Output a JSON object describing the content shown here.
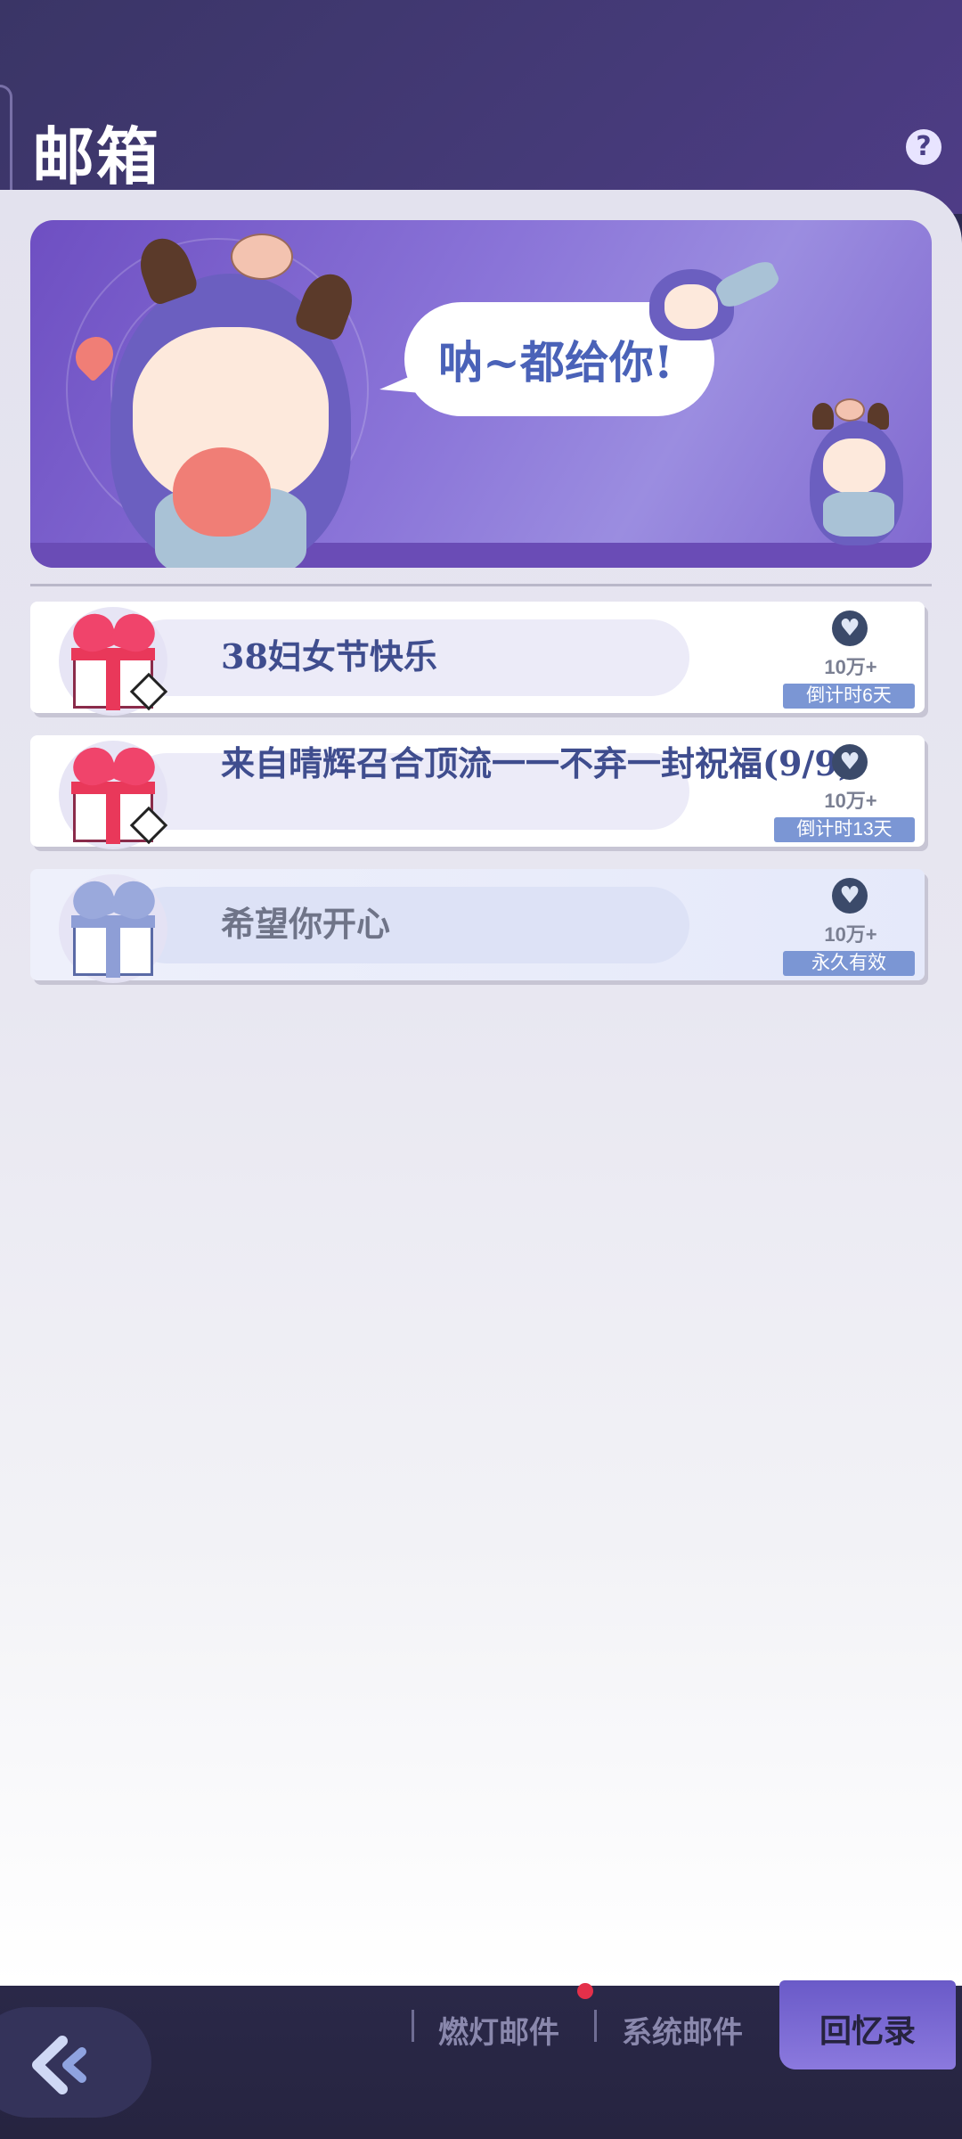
{
  "header": {
    "title": "邮箱",
    "help_icon": "help-icon",
    "help_glyph": "?"
  },
  "banner": {
    "speech": "呐~都给你!"
  },
  "mails": [
    {
      "title": "38妇女节快乐",
      "icon": "gift-red-icon",
      "count": "10万+",
      "expire": "倒计时6天",
      "heart_glyph": "♥"
    },
    {
      "title": "来自晴辉召合顶流一一不弃一封祝福(9/9)",
      "icon": "gift-red-icon",
      "count": "10万+",
      "expire": "倒计时13天",
      "heart_glyph": "♥"
    },
    {
      "title": "希望你开心",
      "icon": "gift-blue-icon",
      "count": "10万+",
      "expire": "永久有效",
      "heart_glyph": "♥"
    }
  ],
  "bottom_nav": {
    "back_icon": "back-arrow-icon",
    "tabs": [
      {
        "label": "燃灯邮件",
        "has_notification": true
      },
      {
        "label": "系统邮件",
        "has_notification": false
      }
    ],
    "memory_label": "回忆录"
  },
  "colors": {
    "header_bg": "#453a78",
    "title_text": "#3f4d8e",
    "expire_badge": "#7b96d4",
    "notification_dot": "#e4304a",
    "memory_button": "#7a68d4"
  }
}
